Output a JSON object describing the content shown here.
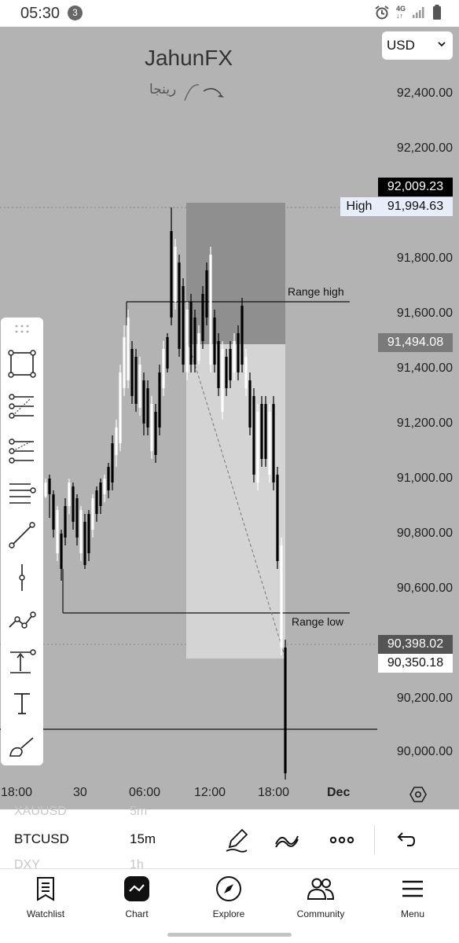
{
  "status_bar": {
    "time": "05:30",
    "notification_count": "3",
    "network": "4G"
  },
  "chart_header": {
    "brand": "JahunFX",
    "sub_brand": "رينجا"
  },
  "currency_select": {
    "value": "USD"
  },
  "colors": {
    "chart_bg": "#b3b3b3",
    "zone_dark": "#8f8f8f",
    "zone_light": "#d4d4d4",
    "candle_up": "#ffffff",
    "candle_down": "#000000"
  },
  "price_axis": {
    "labels": [
      "92,400.00",
      "92,200.00",
      "91,800.00",
      "91,600.00",
      "91,400.00",
      "91,200.00",
      "91,000.00",
      "90,800.00",
      "90,600.00",
      "90,200.00",
      "90,000.00"
    ],
    "tags": {
      "last": "92,009.23",
      "high_label": "High",
      "high": "91,994.63",
      "zone": "91,494.08",
      "bid": "90,398.02",
      "ask": "90,350.18"
    }
  },
  "annotations": {
    "range_high": "Range high",
    "range_low": "Range low"
  },
  "time_axis": {
    "labels": [
      "18:00",
      "30",
      "06:00",
      "12:00",
      "18:00"
    ],
    "month": "Dec"
  },
  "drawing_tools": [
    {
      "name": "rectangle-tool-icon"
    },
    {
      "name": "fib-retracement-icon"
    },
    {
      "name": "fib-extension-icon"
    },
    {
      "name": "horizontal-lines-icon"
    },
    {
      "name": "trend-line-icon"
    },
    {
      "name": "vertical-line-icon"
    },
    {
      "name": "path-icon"
    },
    {
      "name": "long-position-icon"
    },
    {
      "name": "text-tool-icon"
    },
    {
      "name": "brush-icon"
    }
  ],
  "symbol_strip": {
    "prev_symbol": "XAUUSD",
    "prev_interval": "5m",
    "symbol": "BTCUSD",
    "interval": "15m",
    "next_symbol": "DXY",
    "next_interval": "1h"
  },
  "navbar": {
    "items": [
      {
        "label": "Watchlist",
        "icon": "watchlist-icon"
      },
      {
        "label": "Chart",
        "icon": "chart-icon"
      },
      {
        "label": "Explore",
        "icon": "compass-icon"
      },
      {
        "label": "Community",
        "icon": "community-icon"
      },
      {
        "label": "Menu",
        "icon": "menu-icon"
      }
    ]
  }
}
